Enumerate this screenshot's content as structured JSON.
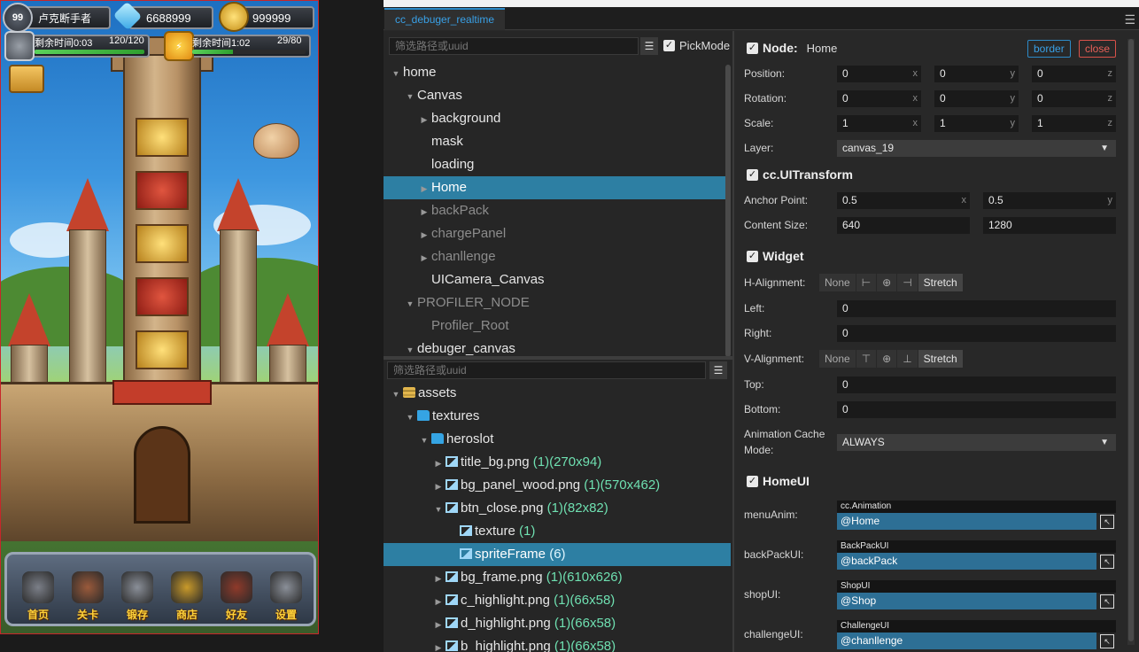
{
  "game": {
    "player_level": "99",
    "player_name": "卢克断手者",
    "diamonds": "6688999",
    "gold": "999999",
    "timer1_label": "剩余时间0:03",
    "timer1_count": "120/120",
    "timer1_fill": 1.0,
    "timer2_label": "剩余时间1:02",
    "timer2_count": "29/80",
    "timer2_fill": 0.36,
    "menu": [
      {
        "label": "首页",
        "icon": "home-tower-icon",
        "color": "#7b7f88"
      },
      {
        "label": "关卡",
        "icon": "level-warrior-icon",
        "color": "#9a5a3b"
      },
      {
        "label": "锻存",
        "icon": "crossed-swords-icon",
        "color": "#8a8f98"
      },
      {
        "label": "商店",
        "icon": "treasure-chest-icon",
        "color": "#c99a2a"
      },
      {
        "label": "好友",
        "icon": "friends-cannon-icon",
        "color": "#8f3a2a"
      },
      {
        "label": "设置",
        "icon": "gear-icon",
        "color": "#8a8f98"
      }
    ]
  },
  "debugger": {
    "tab_title": "cc_debuger_realtime",
    "hierarchy": {
      "filter_placeholder": "筛选路径或uuid",
      "pickmode_label": "PickMode",
      "rows": [
        {
          "label": "home",
          "depth": 0,
          "arrow": "▼",
          "dim": false,
          "sel": false
        },
        {
          "label": "Canvas",
          "depth": 1,
          "arrow": "▼",
          "dim": false,
          "sel": false
        },
        {
          "label": "background",
          "depth": 2,
          "arrow": "▶",
          "dim": false,
          "sel": false
        },
        {
          "label": "mask",
          "depth": 2,
          "arrow": "",
          "dim": false,
          "sel": false
        },
        {
          "label": "loading",
          "depth": 2,
          "arrow": "",
          "dim": false,
          "sel": false
        },
        {
          "label": "Home",
          "depth": 2,
          "arrow": "▶",
          "dim": false,
          "sel": true
        },
        {
          "label": "backPack",
          "depth": 2,
          "arrow": "▶",
          "dim": true,
          "sel": false
        },
        {
          "label": "chargePanel",
          "depth": 2,
          "arrow": "▶",
          "dim": true,
          "sel": false
        },
        {
          "label": "chanllenge",
          "depth": 2,
          "arrow": "▶",
          "dim": true,
          "sel": false
        },
        {
          "label": "UICamera_Canvas",
          "depth": 2,
          "arrow": "",
          "dim": false,
          "sel": false
        },
        {
          "label": "PROFILER_NODE",
          "depth": 1,
          "arrow": "▼",
          "dim": true,
          "sel": false
        },
        {
          "label": "Profiler_Root",
          "depth": 2,
          "arrow": "",
          "dim": true,
          "sel": false
        },
        {
          "label": "debuger_canvas",
          "depth": 1,
          "arrow": "▼",
          "dim": false,
          "sel": false
        }
      ]
    },
    "assets": {
      "filter_placeholder": "筛选路径或uuid",
      "rows": [
        {
          "label": "assets",
          "meta": "",
          "depth": 0,
          "arrow": "▼",
          "icon": "db",
          "sel": false
        },
        {
          "label": "textures",
          "meta": "",
          "depth": 1,
          "arrow": "▼",
          "icon": "folder",
          "sel": false
        },
        {
          "label": "heroslot",
          "meta": "",
          "depth": 2,
          "arrow": "▼",
          "icon": "folder",
          "sel": false
        },
        {
          "label": "title_bg.png",
          "meta": " (1)(270x94)",
          "depth": 3,
          "arrow": "▶",
          "icon": "img",
          "sel": false
        },
        {
          "label": "bg_panel_wood.png",
          "meta": " (1)(570x462)",
          "depth": 3,
          "arrow": "▶",
          "icon": "img",
          "sel": false
        },
        {
          "label": "btn_close.png",
          "meta": " (1)(82x82)",
          "depth": 3,
          "arrow": "▼",
          "icon": "img",
          "sel": false
        },
        {
          "label": "texture",
          "meta": " (1)",
          "depth": 4,
          "arrow": "",
          "icon": "img",
          "sel": false
        },
        {
          "label": "spriteFrame",
          "meta": " (6)",
          "depth": 4,
          "arrow": "",
          "icon": "img",
          "sel": true
        },
        {
          "label": "bg_frame.png",
          "meta": " (1)(610x626)",
          "depth": 3,
          "arrow": "▶",
          "icon": "img",
          "sel": false
        },
        {
          "label": "c_highlight.png",
          "meta": " (1)(66x58)",
          "depth": 3,
          "arrow": "▶",
          "icon": "img",
          "sel": false
        },
        {
          "label": "d_highlight.png",
          "meta": " (1)(66x58)",
          "depth": 3,
          "arrow": "▶",
          "icon": "img",
          "sel": false
        },
        {
          "label": "b_highlight.png",
          "meta": " (1)(66x58)",
          "depth": 3,
          "arrow": "▶",
          "icon": "img",
          "sel": false
        }
      ]
    },
    "inspector": {
      "node_title": "Node:",
      "node_name": "Home",
      "border_btn": "border",
      "close_btn": "close",
      "position_label": "Position:",
      "position": [
        "0",
        "0",
        "0"
      ],
      "rotation_label": "Rotation:",
      "rotation": [
        "0",
        "0",
        "0"
      ],
      "scale_label": "Scale:",
      "scale": [
        "1",
        "1",
        "1"
      ],
      "axes3": [
        "x",
        "y",
        "z"
      ],
      "axes2": [
        "x",
        "y"
      ],
      "layer_label": "Layer:",
      "layer_value": "canvas_19",
      "uitransform_title": "cc.UITransform",
      "anchor_label": "Anchor Point:",
      "anchor": [
        "0.5",
        "0.5"
      ],
      "content_size_label": "Content Size:",
      "content_size": [
        "640",
        "1280"
      ],
      "widget_title": "Widget",
      "h_align_label": "H-Alignment:",
      "v_align_label": "V-Alignment:",
      "align_none": "None",
      "align_stretch": "Stretch",
      "left_label": "Left:",
      "left_value": "0",
      "right_label": "Right:",
      "right_value": "0",
      "top_label": "Top:",
      "top_value": "0",
      "bottom_label": "Bottom:",
      "bottom_value": "0",
      "anim_cache_label_1": "Animation Cache",
      "anim_cache_label_2": "Mode:",
      "anim_cache_value": "ALWAYS",
      "homeui_title": "HomeUI",
      "refs": [
        {
          "label": "menuAnim:",
          "type": "cc.Animation",
          "value": "@Home"
        },
        {
          "label": "backPackUI:",
          "type": "BackPackUI",
          "value": "@backPack"
        },
        {
          "label": "shopUI:",
          "type": "ShopUI",
          "value": "@Shop"
        },
        {
          "label": "challengeUI:",
          "type": "ChallengeUI",
          "value": "@chanllenge"
        }
      ]
    }
  }
}
